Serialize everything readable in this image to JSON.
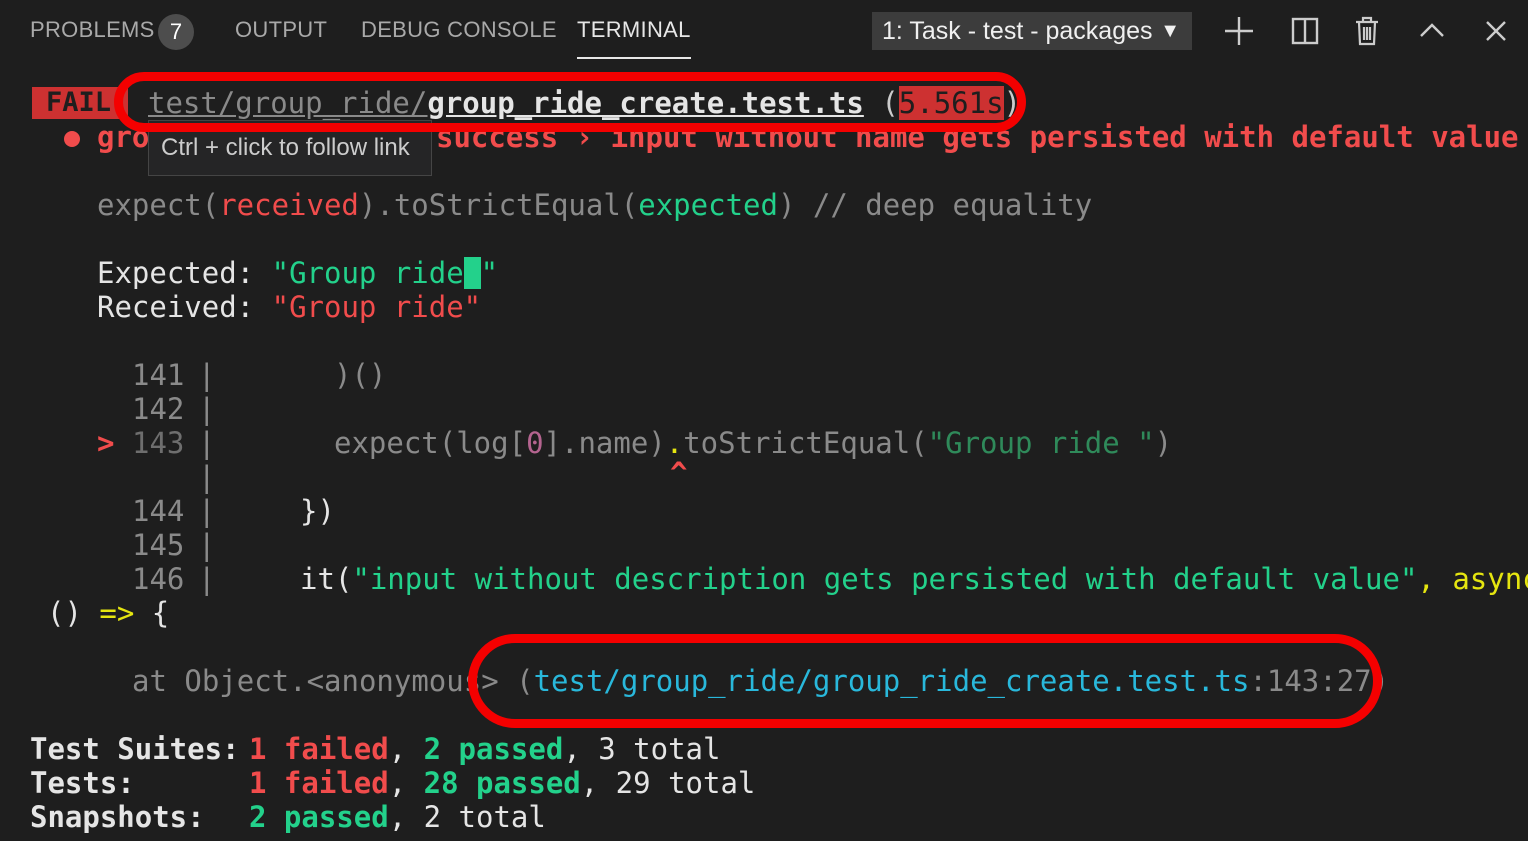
{
  "panel": {
    "tabs": [
      {
        "label": "PROBLEMS",
        "badge": "7"
      },
      {
        "label": "OUTPUT"
      },
      {
        "label": "DEBUG CONSOLE"
      },
      {
        "label": "TERMINAL"
      }
    ],
    "terminal_select": "1: Task - test - packages",
    "icons": [
      "plus-icon",
      "split-icon",
      "trash-icon",
      "chevron-up-icon",
      "close-icon"
    ]
  },
  "terminal": {
    "fail_badge": "FAIL",
    "file_dir": "test/group_ride/",
    "file_name": "group_ride_create.test.ts",
    "duration": "5.561s",
    "test_title_start": "gro",
    "test_title_end": "success › input without name gets persisted with default value",
    "tooltip": "Ctrl + click to follow link",
    "matcher": {
      "expect": "expect(",
      "received": "received",
      "mid": ").toStrictEqual(",
      "expected": "expected",
      "comment": ") // deep equality"
    },
    "expected_label": "Expected: ",
    "expected_value_pre": "\"Group ride",
    "expected_value_post": "\"",
    "received_label": "Received: ",
    "received_value": "\"Group ride\"",
    "code": {
      "l141": "141",
      "l141_code": ")()",
      "l142": "142",
      "l143_marker": ">",
      "l143": "143",
      "l143_a": "expect(log[",
      "l143_zero": "0",
      "l143_b": "].name)",
      "l143_dot": ".",
      "l143_c": "toStrictEqual(",
      "l143_str": "\"Group ride \"",
      "l143_d": ")",
      "caret": "^",
      "l144": "144",
      "l144_code": "})",
      "l145": "145",
      "l146": "146",
      "l146_a": "it(",
      "l146_str": "\"input without description gets persisted with default value\"",
      "l146_b": ", async",
      "wrap_a": "()",
      "wrap_arrow": "=>",
      "wrap_b": "{",
      "pipe": "|"
    },
    "stack": {
      "at": "at Object.<anonymous> (",
      "path": "test/group_ride/group_ride_create.test.ts",
      "pos": ":143:27)"
    },
    "summary": {
      "suites_label": "Test Suites:",
      "suites_failed": "1 failed",
      "suites_passed": "2 passed",
      "suites_total": ", 3 total",
      "tests_label": "Tests:",
      "tests_failed": "1 failed",
      "tests_passed": "28 passed",
      "tests_total": ", 29 total",
      "snap_label": "Snapshots:",
      "snap_passed": "2 passed",
      "snap_total": ", 2 total",
      "comma": ","
    }
  },
  "colors": {
    "highlight_ring": "#f40000",
    "fail_bg": "#cd3131",
    "pass": "#23d18b",
    "fail": "#f14c4c",
    "link": "#29b8db"
  }
}
